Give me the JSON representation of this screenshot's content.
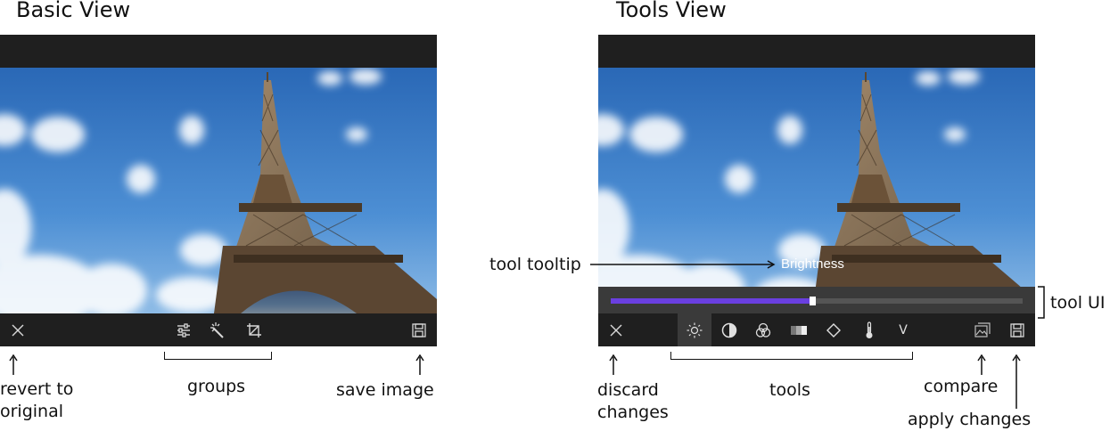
{
  "basic_view": {
    "heading": "Basic View",
    "annotations": {
      "revert": "revert to\noriginal",
      "groups": "groups",
      "save": "save image"
    }
  },
  "tools_view": {
    "heading": "Tools View",
    "tooltip": "Brightness",
    "slider_fraction": 0.49,
    "slider_fill_color": "#6a3fe0",
    "tools_icons": [
      "brightness-icon",
      "contrast-icon",
      "color-icon",
      "gradient-icon",
      "sharpen-icon",
      "temperature-icon",
      "vignette-icon"
    ],
    "vignette_glyph": "V",
    "annotations": {
      "tool_tooltip": "tool tooltip",
      "tool_ui": "tool UI",
      "discard": "discard\nchanges",
      "tools": "tools",
      "compare": "compare",
      "apply": "apply changes"
    }
  }
}
